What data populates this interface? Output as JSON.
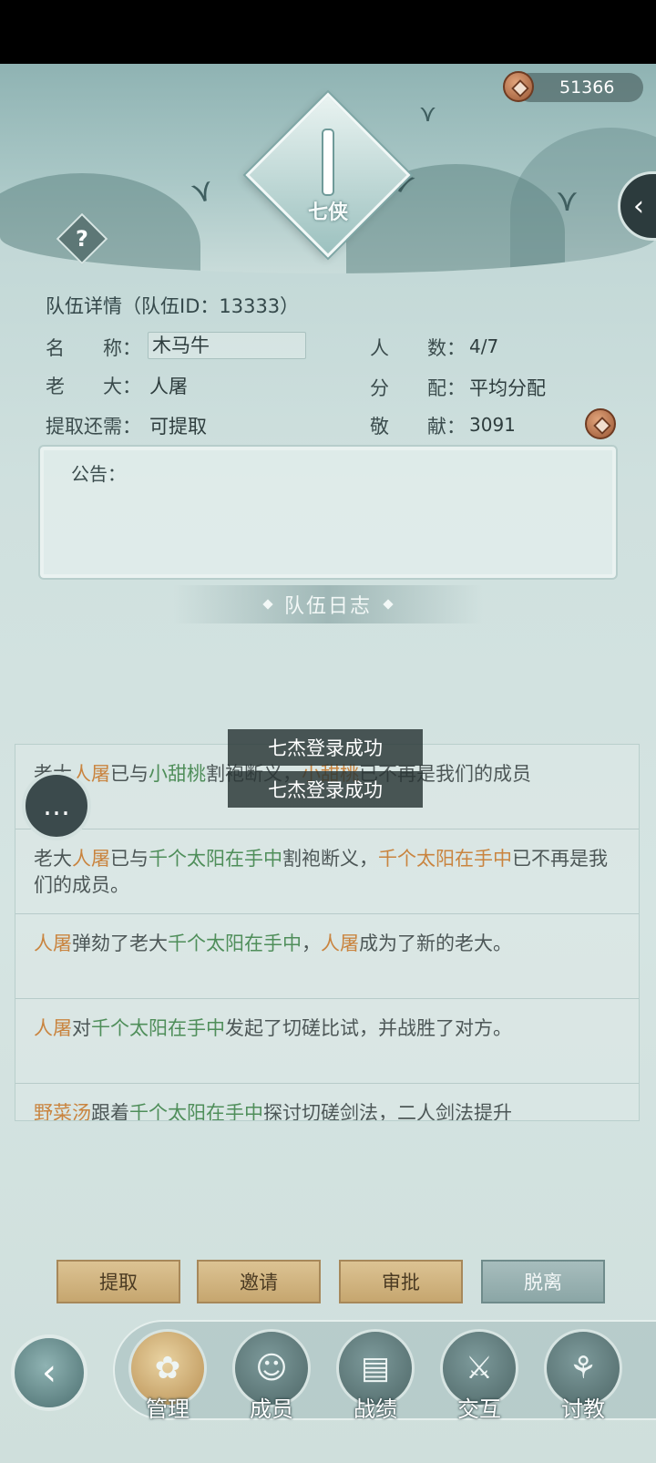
{
  "currency": {
    "amount": "51366",
    "icon": "copper-coin-icon"
  },
  "emblem": {
    "name": "七侠"
  },
  "team": {
    "title": "队伍详情（队伍ID：13333）",
    "name_label": "名　　称：",
    "name_value": "木马牛",
    "count_label": "人　　数：",
    "count_value": "4/7",
    "leader_label": "老　　大：",
    "leader_value": "人屠",
    "distribution_label": "分　　配：",
    "distribution_value": "平均分配",
    "withdraw_label": "提取还需：",
    "withdraw_value": "可提取",
    "contribution_label": "敬　　献：",
    "contribution_value": "3091"
  },
  "notice": {
    "label": "公告："
  },
  "log": {
    "title": "队伍日志",
    "entries": [
      [
        {
          "t": "老大",
          "c": ""
        },
        {
          "t": "人屠",
          "c": "orange"
        },
        {
          "t": "已与",
          "c": ""
        },
        {
          "t": "小甜桃",
          "c": "green"
        },
        {
          "t": "割袍断义，",
          "c": ""
        },
        {
          "t": "小甜桃",
          "c": "orange"
        },
        {
          "t": "已不再是我们的成员",
          "c": ""
        }
      ],
      [
        {
          "t": "老大",
          "c": ""
        },
        {
          "t": "人屠",
          "c": "orange"
        },
        {
          "t": "已与",
          "c": ""
        },
        {
          "t": "千个太阳在手中",
          "c": "green"
        },
        {
          "t": "割袍断义，",
          "c": ""
        },
        {
          "t": "千个太阳在手中",
          "c": "orange"
        },
        {
          "t": "已不再是我们的成员。",
          "c": ""
        }
      ],
      [
        {
          "t": "人屠",
          "c": "orange"
        },
        {
          "t": "弹劾了老大",
          "c": ""
        },
        {
          "t": "千个太阳在手中",
          "c": "green"
        },
        {
          "t": "，",
          "c": ""
        },
        {
          "t": "人屠",
          "c": "orange"
        },
        {
          "t": "成为了新的老大。",
          "c": ""
        }
      ],
      [
        {
          "t": "人屠",
          "c": "orange"
        },
        {
          "t": "对",
          "c": ""
        },
        {
          "t": "千个太阳在手中",
          "c": "green"
        },
        {
          "t": "发起了切磋比试，并战胜了对方。",
          "c": ""
        }
      ],
      [
        {
          "t": "野菜汤",
          "c": "orange"
        },
        {
          "t": "跟着",
          "c": ""
        },
        {
          "t": "千个太阳在手中",
          "c": "green"
        },
        {
          "t": "探讨切磋剑法，二人剑法提升",
          "c": ""
        }
      ]
    ]
  },
  "toasts": [
    "七杰登录成功",
    "七杰登录成功"
  ],
  "actions": {
    "withdraw": "提取",
    "invite": "邀请",
    "approve": "审批",
    "leave": "脱离"
  },
  "nav": [
    {
      "label": "管理",
      "icon": "manage-icon",
      "active": true
    },
    {
      "label": "成员",
      "icon": "members-icon",
      "active": false
    },
    {
      "label": "战绩",
      "icon": "record-scroll-icon",
      "active": false
    },
    {
      "label": "交互",
      "icon": "interaction-icon",
      "active": false
    },
    {
      "label": "讨教",
      "icon": "consult-icon",
      "active": false
    }
  ]
}
